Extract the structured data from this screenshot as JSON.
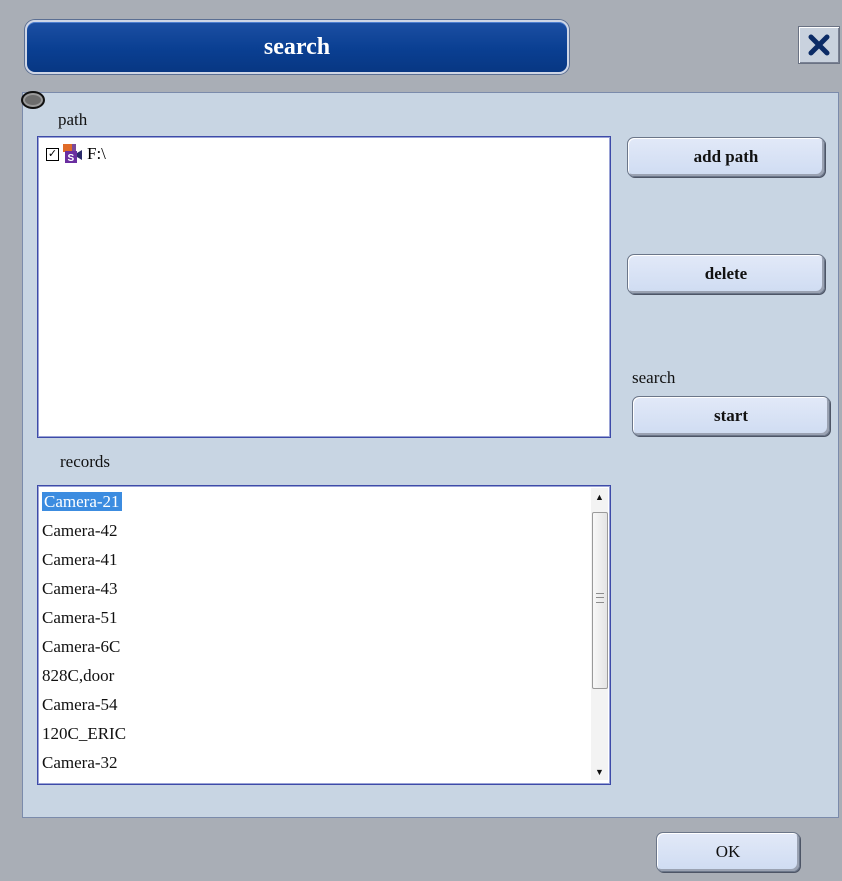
{
  "window": {
    "title": "search",
    "close_icon": "close-icon"
  },
  "path_section": {
    "label": "path",
    "items": [
      {
        "label": "F:\\",
        "checked": true,
        "icon": "camera-drive-icon"
      }
    ]
  },
  "buttons": {
    "add_path": "add path",
    "delete": "delete",
    "start": "start",
    "ok": "OK"
  },
  "search_section": {
    "label": "search"
  },
  "records_section": {
    "label": "records",
    "selected_index": 0,
    "items": [
      "Camera-21",
      "Camera-42",
      "Camera-41",
      "Camera-43",
      "Camera-51",
      "Camera-6C",
      "828C,door",
      "Camera-54",
      "120C_ERIC",
      "Camera-32"
    ]
  },
  "colors": {
    "title_bar": "#0a3f92",
    "panel": "#c8d5e3",
    "selection": "#3c8ce0"
  }
}
